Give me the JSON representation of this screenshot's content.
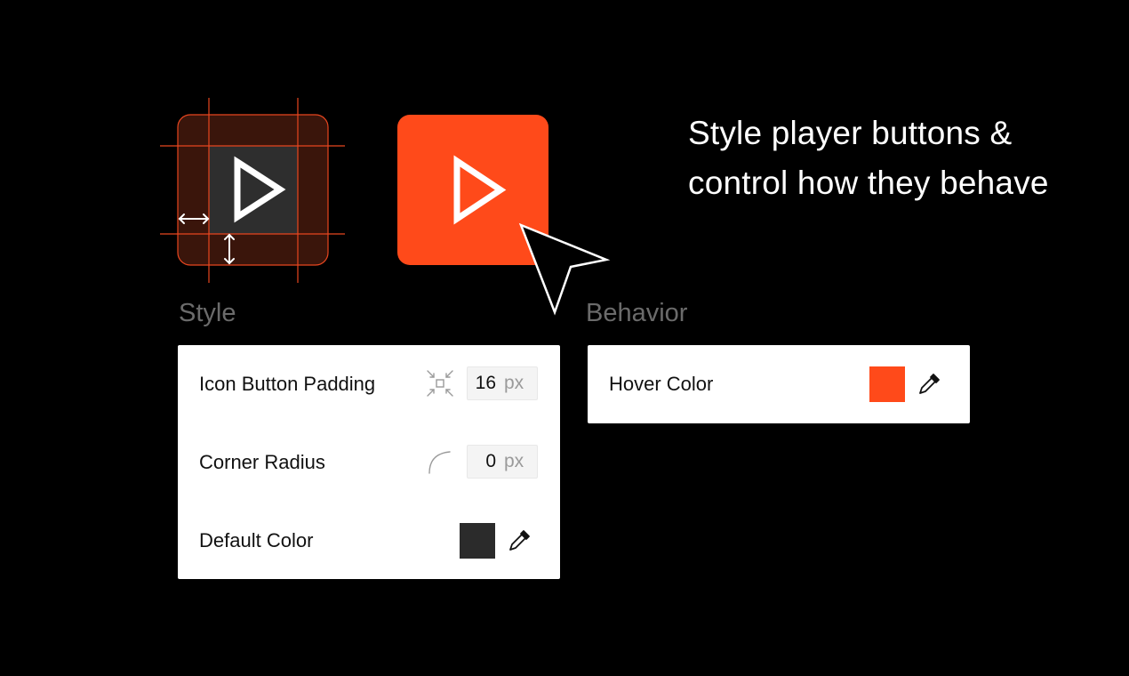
{
  "headline": "Style player buttons & control how they behave",
  "sections": {
    "style": {
      "title": "Style",
      "rows": {
        "padding": {
          "label": "Icon Button Padding",
          "value": "16",
          "unit": "px",
          "icon": "padding-compress-icon"
        },
        "radius": {
          "label": "Corner Radius",
          "value": "0",
          "unit": "px",
          "icon": "corner-radius-icon"
        },
        "color": {
          "label": "Default Color",
          "color": "#2B2B2B",
          "icon": "eyedropper-icon"
        }
      }
    },
    "behavior": {
      "title": "Behavior",
      "rows": {
        "hover": {
          "label": "Hover Color",
          "color": "#FF4A1A",
          "icon": "eyedropper-icon"
        }
      }
    }
  },
  "colors": {
    "accent": "#FF4A1A",
    "background": "#000000",
    "panel": "#FFFFFF",
    "default_button": "#2B2B2B"
  }
}
